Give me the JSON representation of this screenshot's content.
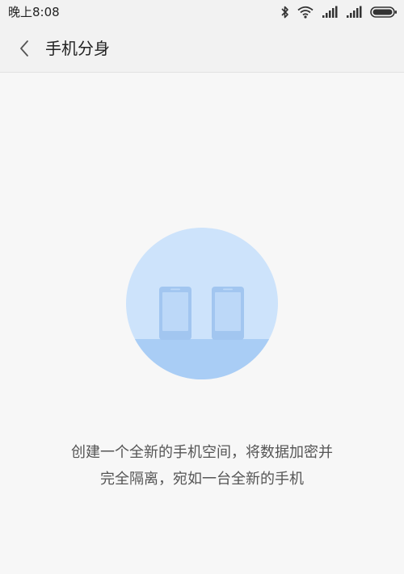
{
  "status_bar": {
    "time": "晚上8:08",
    "icons": [
      "bluetooth-icon",
      "wifi-icon",
      "signal-icon",
      "signal-icon",
      "battery-icon"
    ]
  },
  "header": {
    "back_icon": "chevron-left-icon",
    "title": "手机分身"
  },
  "main": {
    "illustration_icon": "dual-phone-icon",
    "description_line1": "创建一个全新的手机空间，将数据加密并",
    "description_line2": "完全隔离，宛如一台全新的手机"
  },
  "colors": {
    "circle": "#cde3fb",
    "ground": "#a9cdf5",
    "phone": "#a2c6f0",
    "screen": "#bcd8f8"
  }
}
